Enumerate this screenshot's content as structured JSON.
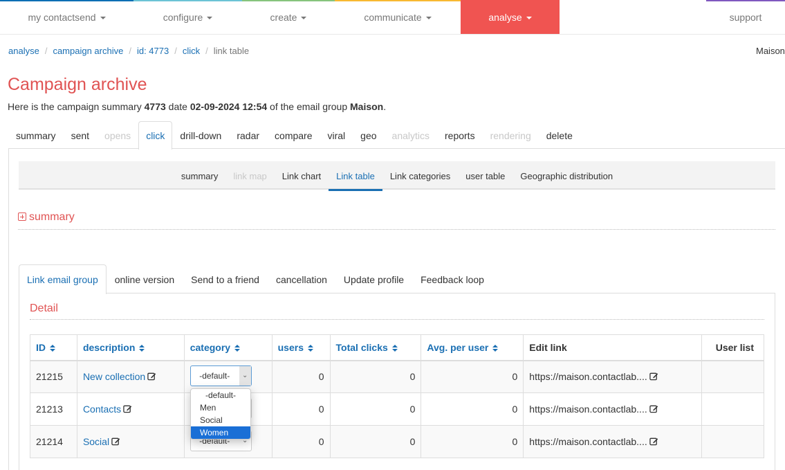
{
  "topnav": {
    "items": [
      {
        "label": "my contactsend",
        "color": "#0a6eb4"
      },
      {
        "label": "configure",
        "color": "#6cc3d5"
      },
      {
        "label": "create",
        "color": "#86c47d"
      },
      {
        "label": "communicate",
        "color": "#f8b932"
      },
      {
        "label": "analyse",
        "color": "#f05451"
      }
    ],
    "support": {
      "label": "support",
      "color": "#8058bf"
    }
  },
  "breadcrumb": {
    "items": [
      "analyse",
      "campaign archive",
      "id: 4773",
      "click"
    ],
    "current": "link table"
  },
  "org_name": "Maison",
  "page": {
    "title": "Campaign archive",
    "subtitle_prefix": "Here is the campaign summary ",
    "campaign_id": "4773",
    "subtitle_date_label": " date ",
    "date": "02-09-2024 12:54",
    "subtitle_group_label": " of the email group ",
    "group": "Maison",
    "subtitle_suffix": "."
  },
  "main_tabs": [
    {
      "label": "summary",
      "state": "normal"
    },
    {
      "label": "sent",
      "state": "normal"
    },
    {
      "label": "opens",
      "state": "disabled"
    },
    {
      "label": "click",
      "state": "active"
    },
    {
      "label": "drill-down",
      "state": "normal"
    },
    {
      "label": "radar",
      "state": "normal"
    },
    {
      "label": "compare",
      "state": "normal"
    },
    {
      "label": "viral",
      "state": "normal"
    },
    {
      "label": "geo",
      "state": "normal"
    },
    {
      "label": "analytics",
      "state": "disabled"
    },
    {
      "label": "reports",
      "state": "normal"
    },
    {
      "label": "rendering",
      "state": "disabled"
    },
    {
      "label": "delete",
      "state": "normal"
    }
  ],
  "sub_tabs": [
    {
      "label": "summary",
      "state": "normal"
    },
    {
      "label": "link map",
      "state": "disabled"
    },
    {
      "label": "Link chart",
      "state": "normal"
    },
    {
      "label": "Link table",
      "state": "active"
    },
    {
      "label": "Link categories",
      "state": "normal"
    },
    {
      "label": "user table",
      "state": "normal"
    },
    {
      "label": "Geographic distribution",
      "state": "normal"
    }
  ],
  "summary_section": {
    "label": "summary",
    "collapsed": true
  },
  "group_tabs": [
    {
      "label": "Link email group",
      "state": "active"
    },
    {
      "label": "online version",
      "state": "normal"
    },
    {
      "label": "Send to a friend",
      "state": "normal"
    },
    {
      "label": "cancellation",
      "state": "normal"
    },
    {
      "label": "Update profile",
      "state": "normal"
    },
    {
      "label": "Feedback loop",
      "state": "normal"
    }
  ],
  "detail_title": "Detail",
  "table": {
    "columns": [
      {
        "label": "ID",
        "sortable": true
      },
      {
        "label": "description",
        "sortable": true
      },
      {
        "label": "category",
        "sortable": true
      },
      {
        "label": "users",
        "sortable": true
      },
      {
        "label": "Total clicks",
        "sortable": true
      },
      {
        "label": "Avg. per user",
        "sortable": true
      },
      {
        "label": "Edit link",
        "sortable": false
      },
      {
        "label": "User list",
        "sortable": false
      }
    ],
    "rows": [
      {
        "id": "21215",
        "description": "New collection",
        "category": "-default-",
        "users": "0",
        "total_clicks": "0",
        "avg_per_user": "0",
        "link": "https://maison.contactlab....",
        "user_list": ""
      },
      {
        "id": "21213",
        "description": "Contacts",
        "category": "-default-",
        "users": "0",
        "total_clicks": "0",
        "avg_per_user": "0",
        "link": "https://maison.contactlab....",
        "user_list": ""
      },
      {
        "id": "21214",
        "description": "Social",
        "category": "-default-",
        "users": "0",
        "total_clicks": "0",
        "avg_per_user": "0",
        "link": "https://maison.contactlab....",
        "user_list": ""
      }
    ]
  },
  "category_dropdown": {
    "open_on_row": 0,
    "options": [
      "-default-",
      "Men",
      "Social",
      "Women"
    ],
    "highlighted": "Women"
  }
}
